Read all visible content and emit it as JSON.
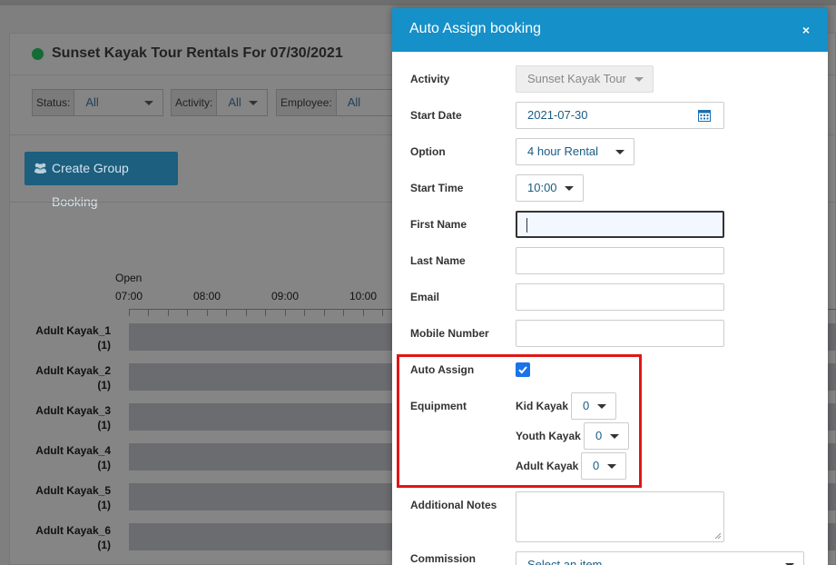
{
  "page": {
    "title": "Sunset Kayak Tour Rentals For 07/30/2021",
    "filters": [
      {
        "label": "Status:",
        "value": "All"
      },
      {
        "label": "Activity:",
        "value": "All"
      },
      {
        "label": "Employee:",
        "value": "All"
      }
    ],
    "create_group_label": "Create Group Booking",
    "timeline": {
      "open_label": "Open",
      "times": [
        "07:00",
        "08:00",
        "09:00",
        "10:00"
      ],
      "rows": [
        {
          "name": "Adult Kayak_1",
          "count": "(1)"
        },
        {
          "name": "Adult Kayak_2",
          "count": "(1)"
        },
        {
          "name": "Adult Kayak_3",
          "count": "(1)"
        },
        {
          "name": "Adult Kayak_4",
          "count": "(1)"
        },
        {
          "name": "Adult Kayak_5",
          "count": "(1)"
        },
        {
          "name": "Adult Kayak_6",
          "count": "(1)"
        }
      ]
    }
  },
  "modal": {
    "title": "Auto Assign booking",
    "close": "×",
    "fields": {
      "activity": {
        "label": "Activity",
        "value": "Sunset Kayak Tour"
      },
      "start_date": {
        "label": "Start Date",
        "value": "2021-07-30"
      },
      "option": {
        "label": "Option",
        "value": "4 hour Rental"
      },
      "start_time": {
        "label": "Start Time",
        "value": "10:00"
      },
      "first_name": {
        "label": "First Name",
        "value": ""
      },
      "last_name": {
        "label": "Last Name",
        "value": ""
      },
      "email": {
        "label": "Email",
        "value": ""
      },
      "mobile": {
        "label": "Mobile Number",
        "value": ""
      },
      "auto_assign": {
        "label": "Auto Assign",
        "checked": true
      },
      "equipment": {
        "label": "Equipment",
        "items": [
          {
            "name": "Kid Kayak",
            "value": "0"
          },
          {
            "name": "Youth Kayak",
            "value": "0"
          },
          {
            "name": "Adult Kayak",
            "value": "0"
          }
        ]
      },
      "notes": {
        "label": "Additional Notes",
        "value": ""
      },
      "commission": {
        "label": "Commission",
        "placeholder": "Select an item"
      }
    }
  },
  "colors": {
    "modal_header": "#1590c8",
    "highlight": "#e01616",
    "checkbox": "#1a73e8",
    "status_dot": "#136b36"
  }
}
